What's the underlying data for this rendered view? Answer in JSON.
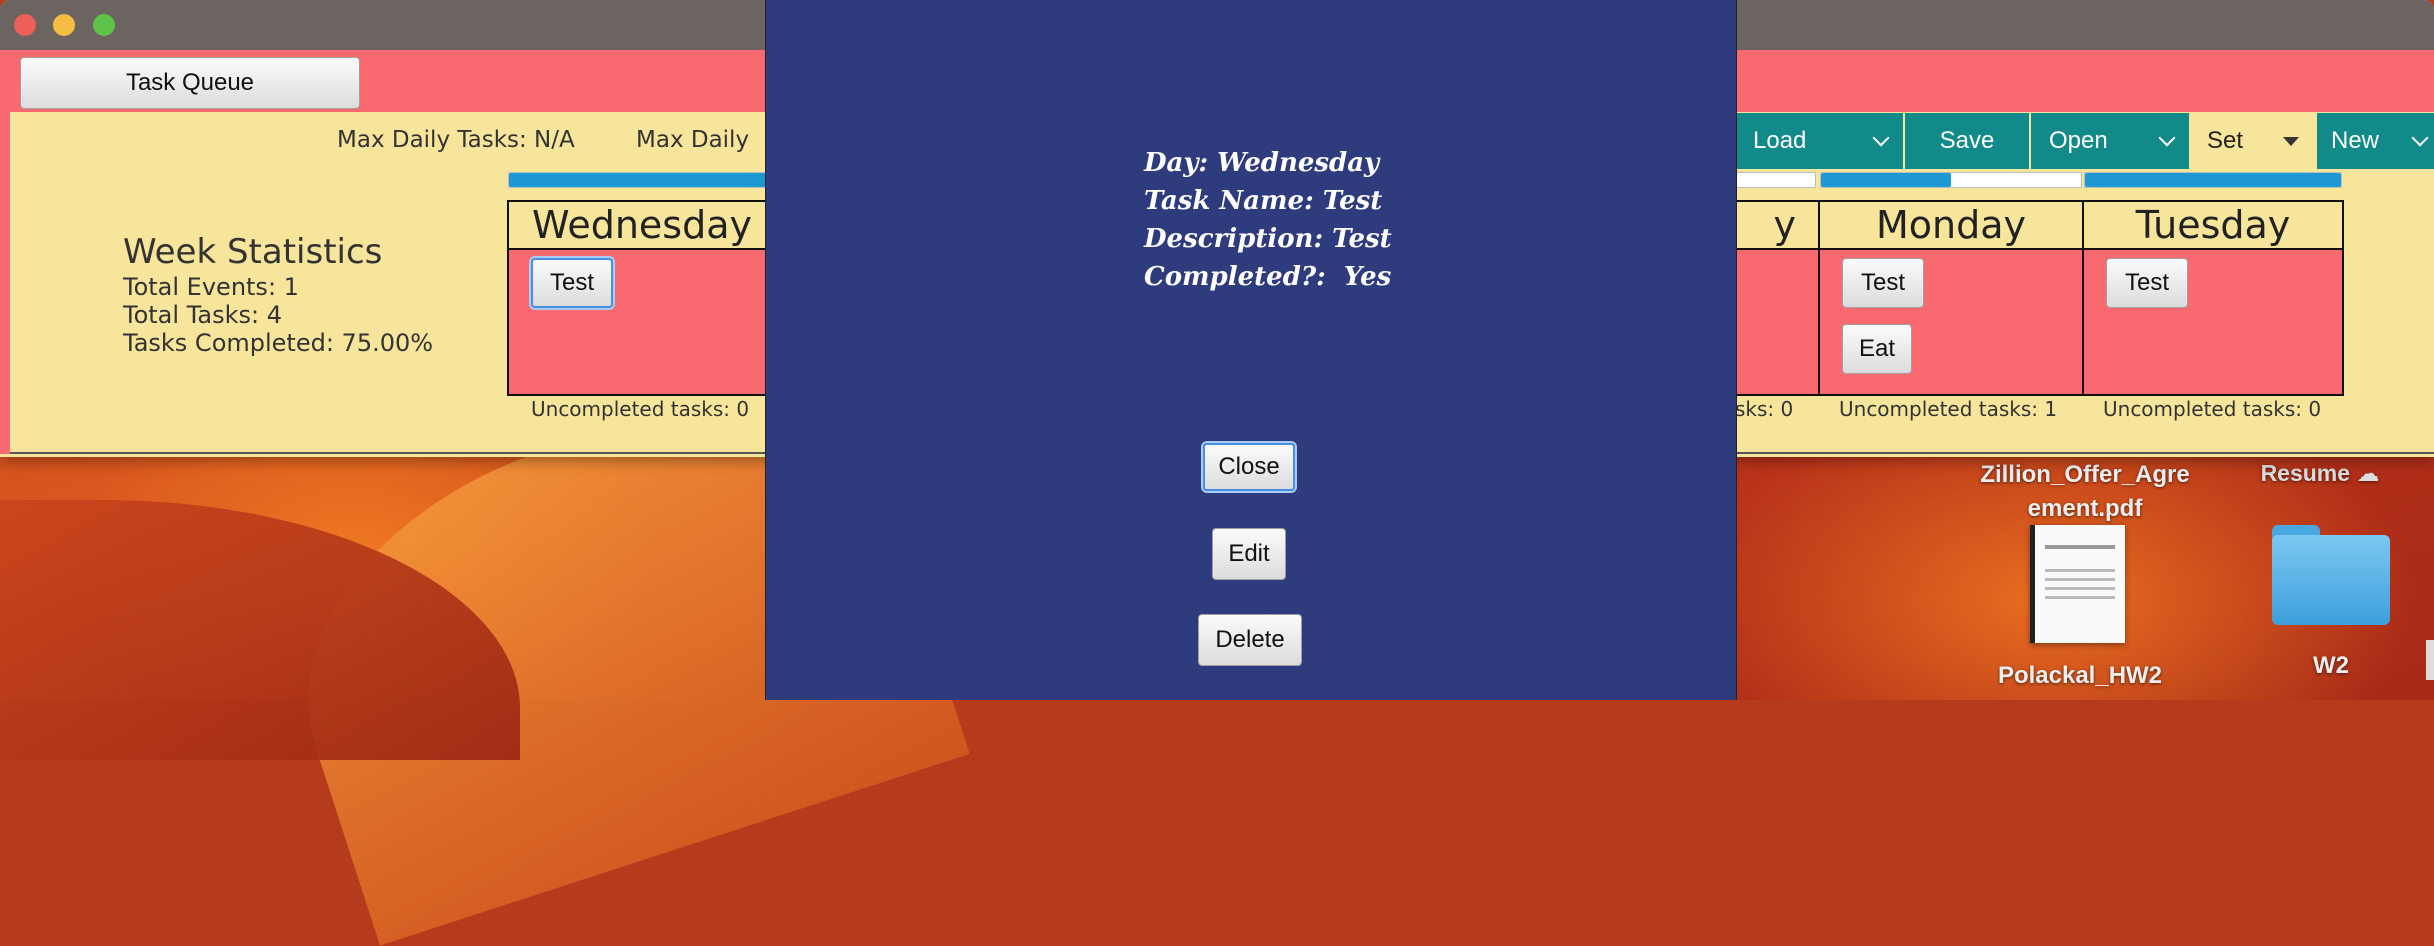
{
  "window": {
    "task_queue_label": "Task Queue",
    "max_daily_1": "Max Daily Tasks: N/A",
    "max_daily_2": "Max Daily"
  },
  "stats": {
    "title": "Week Statistics",
    "events": "Total Events: 1",
    "tasks": "Total Tasks: 4",
    "completed": "Tasks Completed: 75.00%"
  },
  "toolbar": {
    "load": "Load",
    "save": "Save",
    "open": "Open",
    "set": "Set",
    "new": "New"
  },
  "days": {
    "wednesday": {
      "name": "Wednesday",
      "tasks": [
        "Test"
      ],
      "uncompleted": "Uncompleted tasks: 0",
      "progress": 1.0
    },
    "partial": {
      "name_fragment": "y",
      "uncompleted_fragment": "sks: 0"
    },
    "monday": {
      "name": "Monday",
      "tasks": [
        "Test",
        "Eat"
      ],
      "uncompleted": "Uncompleted tasks: 1",
      "progress": 0.5
    },
    "tuesday": {
      "name": "Tuesday",
      "tasks": [
        "Test"
      ],
      "uncompleted": "Uncompleted tasks: 0",
      "progress": 1.0
    }
  },
  "dialog": {
    "day": "Day: Wednesday",
    "task_name": "Task Name: Test",
    "description": "Description: Test",
    "completed": "Completed?:  Yes",
    "close": "Close",
    "edit": "Edit",
    "delete": "Delete"
  },
  "desktop": {
    "pdf_name_line1": "Zillion_Offer_Agre",
    "pdf_name_line2": "ement.pdf",
    "resume_label": "Resume",
    "doc_label": "Polackal_HW2",
    "folder_label": "W2"
  },
  "colors": {
    "pink": "#f86a6f",
    "cream": "#f7e59b",
    "teal": "#138a8a",
    "dialog_bg": "#2e3b7d",
    "progress": "#1d98d3"
  }
}
